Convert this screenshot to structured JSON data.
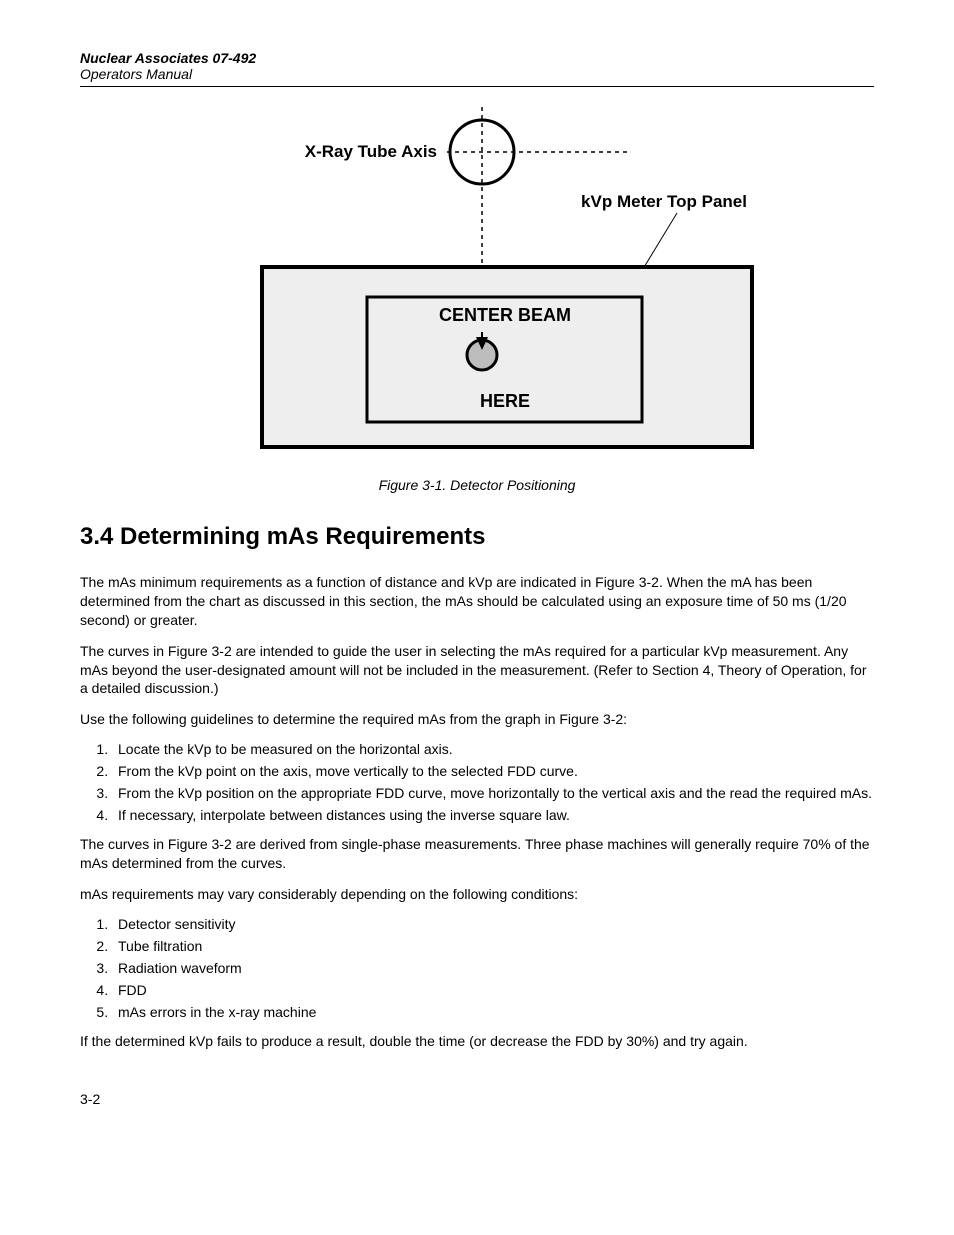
{
  "header": {
    "title": "Nuclear Associates 07-492",
    "subtitle": "Operators Manual"
  },
  "figure": {
    "label_xray_axis": "X-Ray Tube Axis",
    "label_kvp_panel": "kVp Meter Top Panel",
    "label_center_beam": "CENTER BEAM",
    "label_here": "HERE",
    "caption": "Figure 3-1.      Detector Positioning"
  },
  "section": {
    "heading": "3.4 Determining mAs Requirements",
    "p1": "The mAs minimum requirements as a function of distance and kVp are indicated in Figure 3-2.  When the mA has been determined from the chart as discussed in this section, the mAs should be calculated using an exposure time of 50 ms (1/20 second) or greater.",
    "p2": "The curves in Figure 3-2 are intended to guide the user in selecting the mAs required for a particular kVp measurement.  Any mAs beyond the user-designated amount will not be included in the measurement.  (Refer to Section 4, Theory of Operation, for a detailed discussion.)",
    "p3": "Use the following guidelines to determine the required mAs from the graph in Figure 3-2:",
    "list1": {
      "i1": "Locate the kVp to be measured on the horizontal axis.",
      "i2": "From the kVp point on the axis, move vertically to the selected FDD curve.",
      "i3": "From the kVp position on the appropriate FDD curve, move horizontally to the vertical axis and the read the required mAs.",
      "i4": "If necessary, interpolate between distances using the inverse square law."
    },
    "p4": "The curves in Figure 3-2 are derived from single-phase measurements.  Three phase machines will generally require 70% of the mAs determined from the curves.",
    "p5": "mAs requirements may vary considerably depending on the following conditions:",
    "list2": {
      "i1": "Detector sensitivity",
      "i2": "Tube filtration",
      "i3": "Radiation waveform",
      "i4": "FDD",
      "i5": "mAs errors in the x-ray machine"
    },
    "p6": "If the determined kVp fails to produce a result, double the time (or decrease the FDD by 30%) and try again."
  },
  "page_number": "3-2"
}
